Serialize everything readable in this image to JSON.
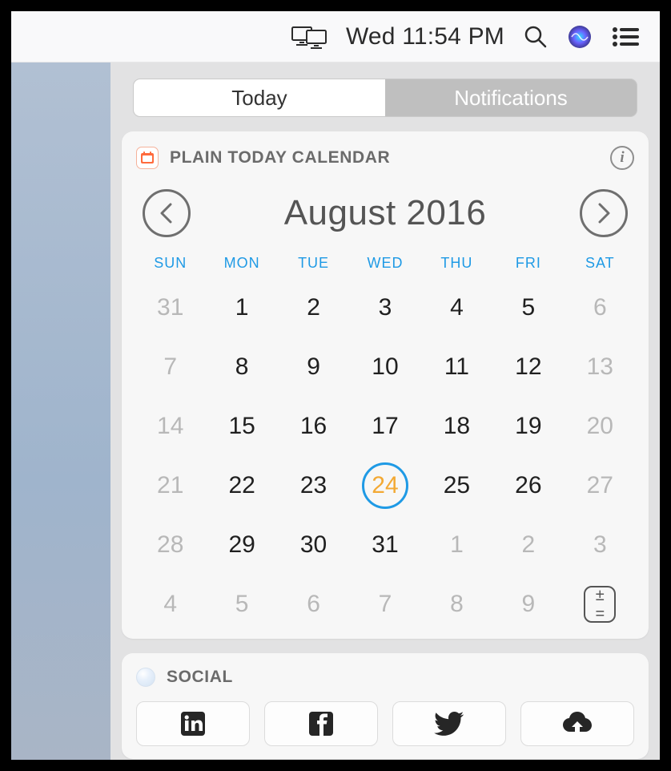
{
  "menubar": {
    "clock": "Wed 11:54 PM"
  },
  "tabs": {
    "today": "Today",
    "notifications": "Notifications"
  },
  "calendar_widget": {
    "title": "PLAIN TODAY CALENDAR",
    "month_label": "August 2016",
    "info_label": "i",
    "dow": [
      "SUN",
      "MON",
      "TUE",
      "WED",
      "THU",
      "FRI",
      "SAT"
    ],
    "days": [
      {
        "n": "31",
        "out": true
      },
      {
        "n": "1"
      },
      {
        "n": "2"
      },
      {
        "n": "3"
      },
      {
        "n": "4"
      },
      {
        "n": "5"
      },
      {
        "n": "6",
        "out": true
      },
      {
        "n": "7",
        "out": true
      },
      {
        "n": "8"
      },
      {
        "n": "9"
      },
      {
        "n": "10"
      },
      {
        "n": "11"
      },
      {
        "n": "12"
      },
      {
        "n": "13",
        "out": true
      },
      {
        "n": "14",
        "out": true
      },
      {
        "n": "15"
      },
      {
        "n": "16"
      },
      {
        "n": "17"
      },
      {
        "n": "18"
      },
      {
        "n": "19"
      },
      {
        "n": "20",
        "out": true
      },
      {
        "n": "21",
        "out": true
      },
      {
        "n": "22"
      },
      {
        "n": "23"
      },
      {
        "n": "24",
        "today": true
      },
      {
        "n": "25"
      },
      {
        "n": "26"
      },
      {
        "n": "27",
        "out": true
      },
      {
        "n": "28",
        "out": true
      },
      {
        "n": "29"
      },
      {
        "n": "30"
      },
      {
        "n": "31"
      },
      {
        "n": "1",
        "out": true
      },
      {
        "n": "2",
        "out": true
      },
      {
        "n": "3",
        "out": true
      },
      {
        "n": "4",
        "out": true
      },
      {
        "n": "5",
        "out": true
      },
      {
        "n": "6",
        "out": true
      },
      {
        "n": "7",
        "out": true
      },
      {
        "n": "8",
        "out": true
      },
      {
        "n": "9",
        "out": true
      },
      {
        "ctrl": true
      }
    ],
    "ctrl": {
      "top": "±",
      "bottom": "="
    }
  },
  "social_widget": {
    "title": "SOCIAL"
  }
}
